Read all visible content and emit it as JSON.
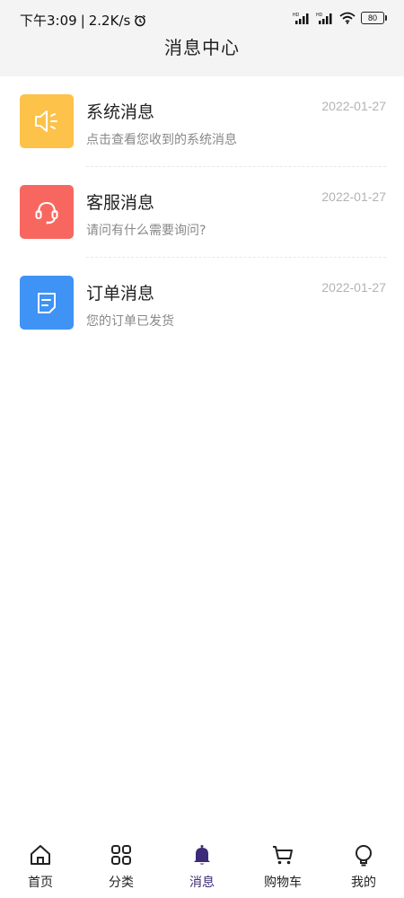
{
  "status_bar": {
    "time": "下午3:09",
    "network_speed": "2.2K/s",
    "battery_level": "80",
    "icons": [
      "alarm-icon",
      "signal-hd-icon",
      "signal-hd-icon",
      "wifi-icon",
      "battery-icon"
    ]
  },
  "header": {
    "title": "消息中心"
  },
  "messages": [
    {
      "title": "系统消息",
      "subtitle": "点击查看您收到的系统消息",
      "date": "2022-01-27",
      "icon": "speaker-icon",
      "color": "#fcc24a"
    },
    {
      "title": "客服消息",
      "subtitle": "请问有什么需要询问?",
      "date": "2022-01-27",
      "icon": "headset-icon",
      "color": "#f8675f"
    },
    {
      "title": "订单消息",
      "subtitle": "您的订单已发货",
      "date": "2022-01-27",
      "icon": "document-icon",
      "color": "#3e93f5"
    }
  ],
  "tab_bar": {
    "active_color": "#3d2a78",
    "items": [
      {
        "label": "首页",
        "icon": "home-icon"
      },
      {
        "label": "分类",
        "icon": "grid-icon"
      },
      {
        "label": "消息",
        "icon": "bell-icon",
        "active": true
      },
      {
        "label": "购物车",
        "icon": "cart-icon"
      },
      {
        "label": "我的",
        "icon": "bulb-icon"
      }
    ]
  }
}
